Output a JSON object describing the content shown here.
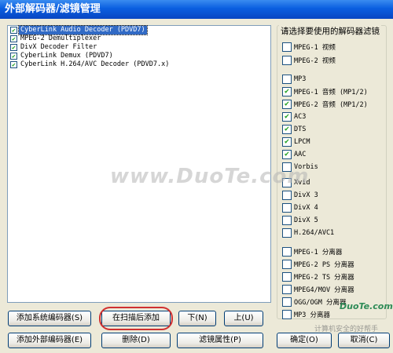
{
  "window": {
    "title": "外部解码器/滤镜管理"
  },
  "filters": [
    {
      "label": "CyberLink Audio Decoder (PDVD7)",
      "checked": true,
      "selected": true
    },
    {
      "label": "MPEG-2 Demultiplexer",
      "checked": true,
      "selected": false
    },
    {
      "label": "DivX Decoder Filter",
      "checked": true,
      "selected": false
    },
    {
      "label": "CyberLink Demux (PDVD7)",
      "checked": true,
      "selected": false
    },
    {
      "label": "CyberLink H.264/AVC Decoder (PDVD7.x)",
      "checked": true,
      "selected": false
    }
  ],
  "decoder_group": {
    "title": "请选择要使用的解码器滤镜",
    "options": [
      {
        "label": "MPEG-1 视频",
        "checked": false
      },
      {
        "label": "MPEG-2 视频",
        "checked": false
      },
      {
        "label": "MP3",
        "checked": false
      },
      {
        "label": "MPEG-1 音频 (MP1/2)",
        "checked": true
      },
      {
        "label": "MPEG-2 音频 (MP1/2)",
        "checked": true
      },
      {
        "label": "AC3",
        "checked": true
      },
      {
        "label": "DTS",
        "checked": true
      },
      {
        "label": "LPCM",
        "checked": true
      },
      {
        "label": "AAC",
        "checked": true
      },
      {
        "label": "Vorbis",
        "checked": false
      },
      {
        "label": "Xvid",
        "checked": false
      },
      {
        "label": "DivX 3",
        "checked": false
      },
      {
        "label": "DivX 4",
        "checked": false
      },
      {
        "label": "DivX 5",
        "checked": false
      },
      {
        "label": "H.264/AVC1",
        "checked": false
      },
      {
        "label": "MPEG-1 分离器",
        "checked": false
      },
      {
        "label": "MPEG-2 PS 分离器",
        "checked": false
      },
      {
        "label": "MPEG-2 TS 分离器",
        "checked": false
      },
      {
        "label": "MPEG4/MOV 分离器",
        "checked": false
      },
      {
        "label": "OGG/OGM 分离器",
        "checked": false
      },
      {
        "label": "MP3 分离器",
        "checked": false
      }
    ]
  },
  "buttons": {
    "add_system": "添加系统编码器(S)",
    "add_after_scan": "在扫描后添加",
    "move_down": "下(N)",
    "move_up": "上(U)",
    "add_external": "添加外部编码器(E)",
    "delete": "删除(D)",
    "filter_props": "滤镜属性(P)",
    "ok": "确定(O)",
    "cancel": "取消(C)"
  },
  "watermarks": {
    "main": "www.DuoTe.com",
    "brand": "DuoTe.com",
    "footer": "计算机安全的好帮手"
  },
  "colors": {
    "title_bar": "#0a5ee0",
    "selection": "#316ac5",
    "highlight_circle": "#d03030"
  }
}
